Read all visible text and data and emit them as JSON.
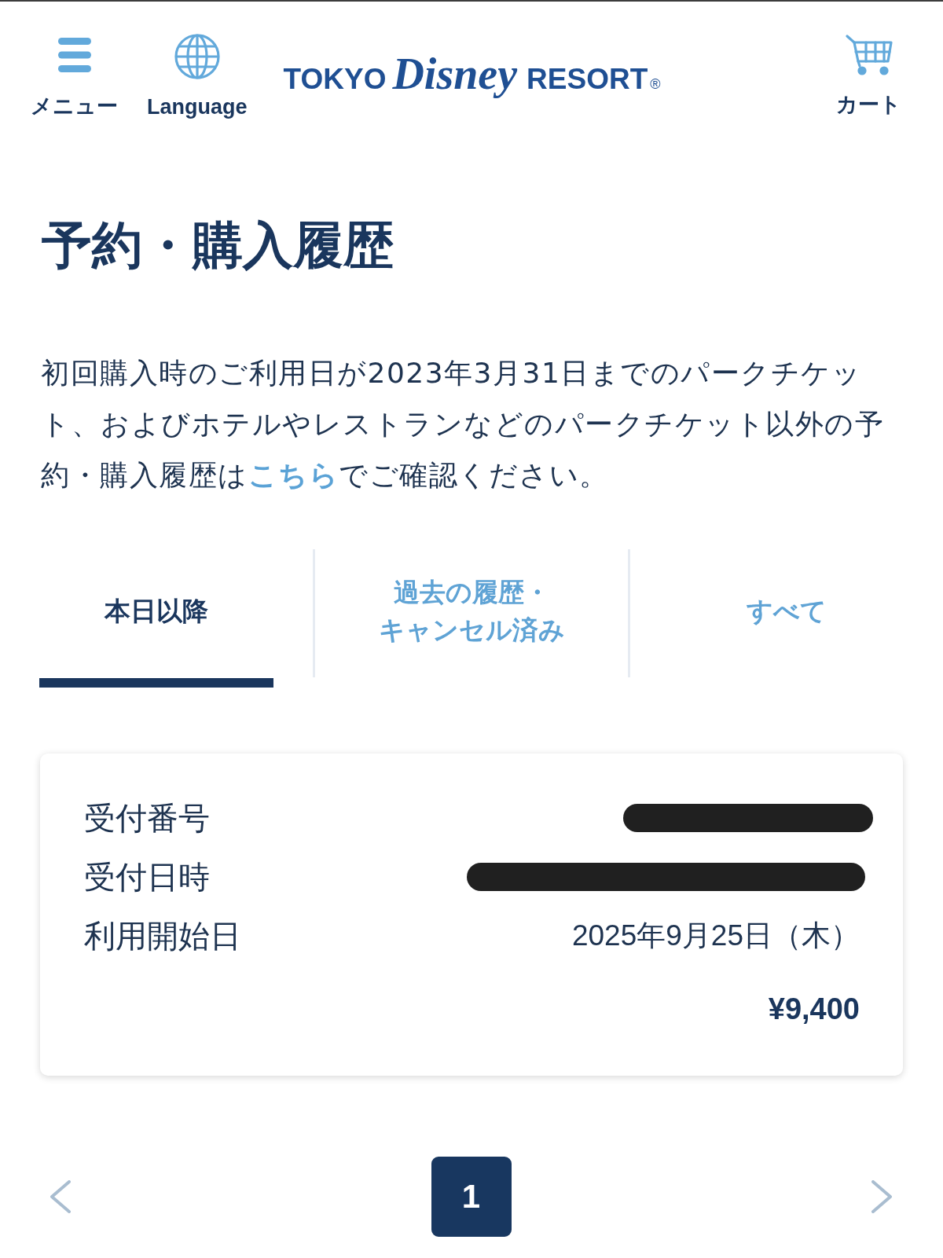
{
  "header": {
    "menu_label": "メニュー",
    "language_label": "Language",
    "logo": {
      "left": "TOKYO",
      "script": "Disney",
      "right": "RESORT",
      "mark": "®"
    },
    "cart_label": "カート"
  },
  "title": "予約・購入履歴",
  "notice": {
    "text_before": "初回購入時のご利用日が2023年3月31日までのパークチケット、およびホテルやレストランなどのパークチケット以外の予約・購入履歴は",
    "link": "こちら",
    "text_after": "でご確認ください。"
  },
  "tabs": [
    {
      "label": "本日以降",
      "selected": true
    },
    {
      "label": "過去の履歴・キャンセル済み",
      "selected": false
    },
    {
      "label": "すべて",
      "selected": false
    }
  ],
  "history": [
    {
      "rows": [
        {
          "label": "受付番号",
          "kind": "redacted"
        },
        {
          "label": "受付日時",
          "kind": "redacted"
        },
        {
          "label": "利用開始日",
          "kind": "text",
          "value": "2025年9月25日（木）"
        }
      ],
      "price": "¥9,400"
    }
  ],
  "pagination": {
    "pages": [
      {
        "label": "1",
        "selected": true
      }
    ]
  }
}
